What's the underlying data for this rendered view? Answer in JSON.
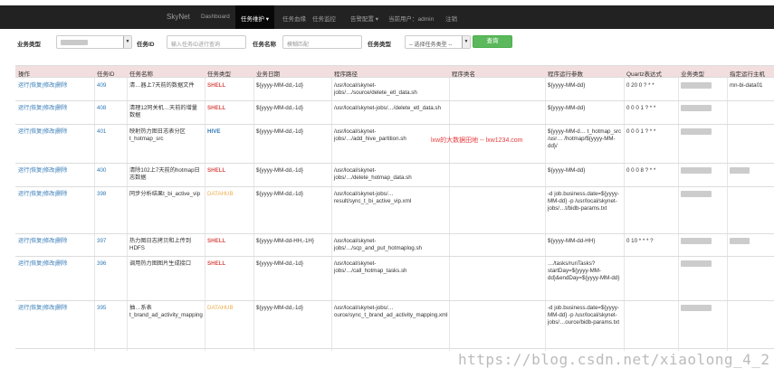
{
  "navbar": {
    "brand": "SkyNet",
    "items": [
      {
        "label": "Dashboard"
      },
      {
        "label": "任务维护 ▾"
      },
      {
        "label": "任务血缘"
      },
      {
        "label": "任务监控"
      },
      {
        "label": "告警配置 ▾"
      },
      {
        "label": "当前用户：admin"
      },
      {
        "label": "注销"
      }
    ]
  },
  "filters": {
    "biz_type_label": "业务类型",
    "task_id_label": "任务ID",
    "task_id_placeholder": "输入任务ID进行查询",
    "task_name_label": "任务名称",
    "task_name_placeholder": "模糊匹配",
    "task_type_label": "任务类型",
    "task_type_select": "-- 选择任务类型 --",
    "query_button": "查询"
  },
  "table": {
    "headers": [
      "操作",
      "任务ID",
      "任务名称",
      "任务类型",
      "业务日期",
      "程序路径",
      "程序类名",
      "程序运行参数",
      "Quartz表达式",
      "业务类型",
      "指定运行主机"
    ],
    "ops_label": "运行|恢复|修改|删除",
    "rows": [
      {
        "id": "409",
        "name": "清…器上7天前的数据文件",
        "type": "SHELL",
        "date": "${yyyy-MM-dd,-1d}",
        "path": "/usr/local/skynet-jobs/…/source/delete_etl_data.sh",
        "param": "${yyyy-MM-dd}",
        "cron": "0 20 0 ? * *",
        "host": "mn-bi-data01"
      },
      {
        "id": "408",
        "name": "清理12同关机…天前的增量数据",
        "type": "SHELL",
        "date": "${yyyy-MM-dd,-1d}",
        "path": "/usr/local/skynet-jobs/…/delete_etl_data.sh",
        "param": "${yyyy-MM-dd}",
        "cron": "0 0 0 1 ? * *",
        "host": ""
      },
      {
        "id": "401",
        "name": "映射热力图日志表分区t_hotmap_src",
        "type": "HIVE",
        "date": "${yyyy-MM-dd,-1d}",
        "path": "/usr/local/skynet-jobs/…/add_hive_partition.sh",
        "param": "${yyyy-MM-d… t_hotmap_src /usr… /hotmap/${yyyy-MM-dd}/",
        "cron": "0 0 0 1 ? * *",
        "host": ""
      },
      {
        "id": "400",
        "name": "清除102上7天前的hotmap日志数据",
        "type": "SHELL",
        "date": "${yyyy-MM-dd,-1d}",
        "path": "/usr/local/skynet-jobs/…/delete_hotmap_data.sh",
        "param": "${yyyy-MM-dd}",
        "cron": "0 0 0 8 ? * *",
        "host": ""
      },
      {
        "id": "398",
        "name": "同步分析结果t_bi_active_vip",
        "type": "DATAHUB",
        "date": "${yyyy-MM-dd,-1d}",
        "path": "/usr/local/skynet-jobs/…result/sync_t_bi_active_vip.xml",
        "param": "-d job.business.date=${yyyy-MM-dd} -p /usr/local/skynet-jobs/…t/bidb-params.txt",
        "cron": "",
        "host": ""
      },
      {
        "id": "397",
        "name": "热力图日志拷贝和上传到HDFS",
        "type": "SHELL",
        "date": "${yyyy-MM-dd-HH,-1H}",
        "path": "/usr/local/skynet-jobs/…/scp_and_put_hotmaplog.sh",
        "param": "${yyyy-MM-dd-HH}",
        "cron": "0 10 * * * ?",
        "host": ""
      },
      {
        "id": "396",
        "name": "调用热力图图片生成接口",
        "type": "SHELL",
        "date": "${yyyy-MM-dd,-1d}",
        "path": "/usr/local/skynet-jobs/…/call_hotmap_tasks.sh",
        "param": "…/tasks/runTasks?startDay=${yyyy-MM-dd}&endDay=${yyyy-MM-dd}",
        "cron": "",
        "host": ""
      },
      {
        "id": "395",
        "name": "抽…系表t_brand_ad_activity_mapping",
        "type": "DATAHUB",
        "date": "${yyyy-MM-dd,-1d}",
        "path": "/usr/local/skynet-jobs/…ource/sync_t_brand_ad_activity_mapping.xml",
        "param": "-d job.business.date=${yyyy-MM-dd} -p /usr/local/skynet-jobs/…ource/bidb-params.txt",
        "cron": "",
        "host": ""
      }
    ]
  },
  "watermark": "lxw的大数据田地 -- lxw1234.com",
  "footer_watermark": "https://blog.csdn.net/xiaolong_4_2"
}
